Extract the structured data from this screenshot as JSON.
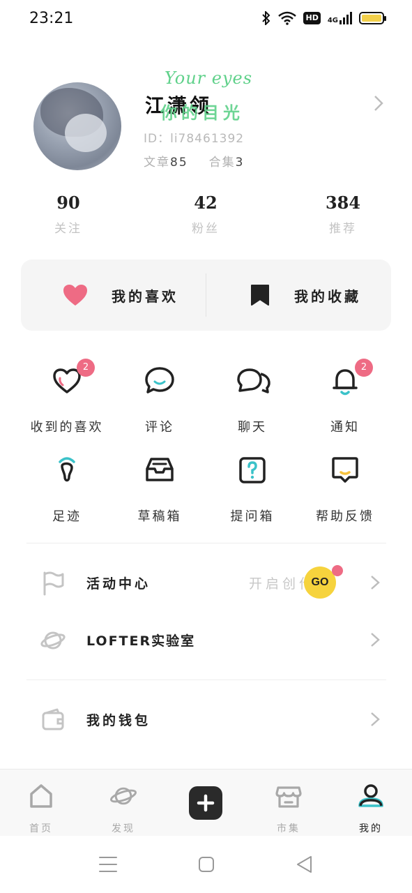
{
  "status_bar": {
    "time": "23:21",
    "hd": "HD",
    "network": "4G"
  },
  "profile": {
    "overlay_en": "Your eyes",
    "overlay_cn": "你的目光",
    "username": "江潇领",
    "id_text": "ID：li78461392",
    "articles_label": "文章",
    "articles_count": "85",
    "collections_label": "合集",
    "collections_count": "3"
  },
  "stats": [
    {
      "value": "90",
      "label": "关注"
    },
    {
      "value": "42",
      "label": "粉丝"
    },
    {
      "value": "384",
      "label": "推荐"
    }
  ],
  "card": {
    "likes_label": "我的喜欢",
    "favorites_label": "我的收藏"
  },
  "grid": [
    {
      "label": "收到的喜欢",
      "badge": "2"
    },
    {
      "label": "评论"
    },
    {
      "label": "聊天"
    },
    {
      "label": "通知",
      "badge": "2"
    },
    {
      "label": "足迹"
    },
    {
      "label": "草稿箱"
    },
    {
      "label": "提问箱"
    },
    {
      "label": "帮助反馈"
    }
  ],
  "rows": {
    "activity_label": "活动中心",
    "activity_right": "开启创作",
    "go_label": "GO",
    "lab_label": "LOFTER实验室",
    "wallet_label": "我的钱包"
  },
  "bottom_nav": [
    {
      "label": "首页"
    },
    {
      "label": "发现"
    },
    {
      "label": "市集"
    },
    {
      "label": "我的"
    }
  ],
  "colors": {
    "accent_pink": "#ee6b84",
    "accent_teal": "#3bc2c9",
    "go_yellow": "#f6d33d",
    "overlay_green": "#5fd18a"
  }
}
